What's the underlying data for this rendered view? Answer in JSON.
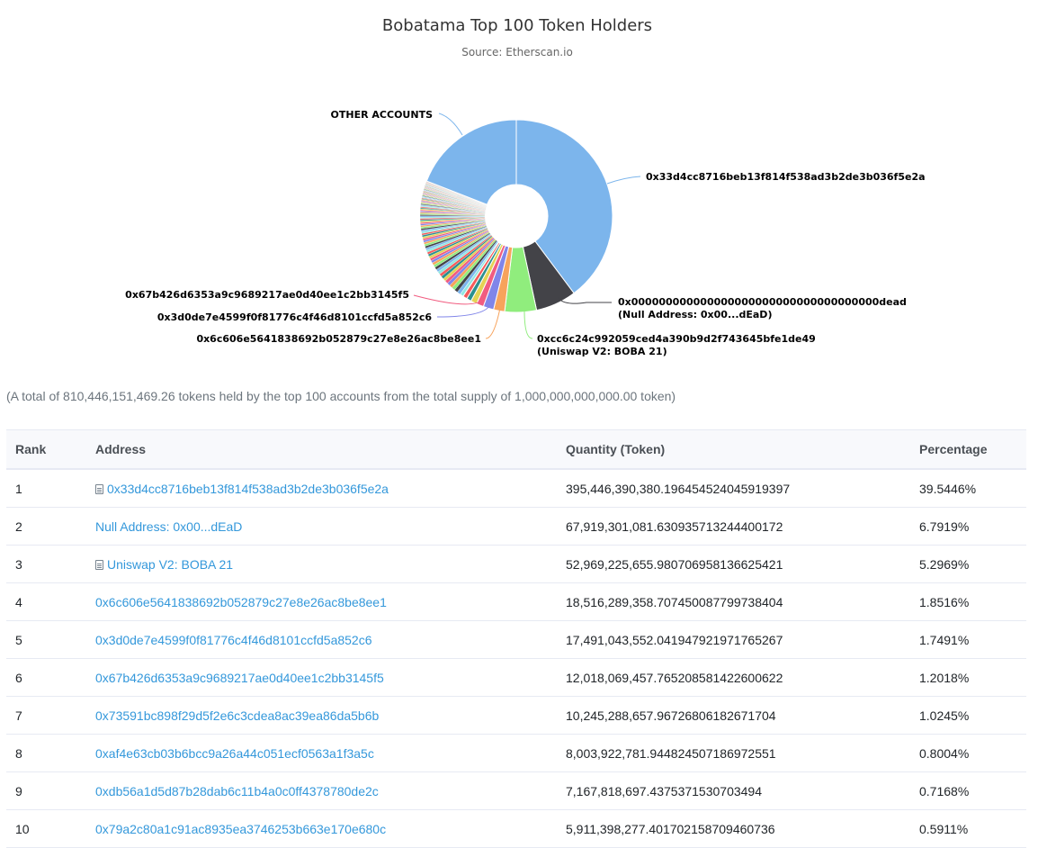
{
  "chart_data": {
    "type": "pie",
    "title": "Bobatama Top 100 Token Holders",
    "subtitle": "Source: Etherscan.io",
    "inner_radius_fraction": 0.33,
    "slices": [
      {
        "label": "0x33d4cc8716beb13f814f538ad3b2de3b036f5e2a",
        "value": 39.5446,
        "color": "#7cb5ec",
        "labeled": true
      },
      {
        "label": "0x000000000000000000000000000000000000dead (Null Address: 0x00...dEaD)",
        "value": 6.7919,
        "color": "#434348",
        "labeled": true
      },
      {
        "label": "0xcc6c24c992059ced4a390b9d2f743645bfe1de49 (Uniswap V2: BOBA 21)",
        "value": 5.2969,
        "color": "#90ed7d",
        "labeled": true
      },
      {
        "label": "0x6c606e5641838692b052879c27e8e26ac8be8ee1",
        "value": 1.8516,
        "color": "#f7a35c",
        "labeled": true
      },
      {
        "label": "0x3d0de7e4599f0f81776c4f46d8101ccfd5a852c6",
        "value": 1.7491,
        "color": "#8085e9",
        "labeled": true
      },
      {
        "label": "0x67b426d6353a9c9689217ae0d40ee1c2bb3145f5",
        "value": 1.2018,
        "color": "#f15c80",
        "labeled": true
      },
      {
        "label": "0x73591bc898f29d5f2e6c3cdea8ac39ea86da5b6b",
        "value": 1.0245,
        "color": "#e4d354",
        "labeled": false
      },
      {
        "label": "0xaf4e63cb03b6bcc9a26a44c051ecf0563a1f3a5c",
        "value": 0.8004,
        "color": "#2b908f",
        "labeled": false
      },
      {
        "label": "0xdb56a1d5d87b28dab6c11b4a0c0ff4378780de2c",
        "value": 0.7168,
        "color": "#f45b5b",
        "labeled": false
      },
      {
        "label": "0x79a2c80a1c91ac8935ea3746253b663e170e680c",
        "value": 0.5911,
        "color": "#91e8e1",
        "labeled": false
      },
      {
        "label": "OTHER ACCOUNTS",
        "value": 18.9554,
        "color": "#7cb5ec",
        "labeled": true
      }
    ],
    "tail": {
      "count": 90,
      "total_value": 20.8799,
      "palette": [
        "#7cb5ec",
        "#434348",
        "#90ed7d",
        "#f7a35c",
        "#8085e9",
        "#f15c80",
        "#e4d354",
        "#2b908f",
        "#f45b5b",
        "#91e8e1"
      ]
    },
    "labels": {
      "other": "OTHER ACCOUNTS",
      "s1": "0x33d4cc8716beb13f814f538ad3b2de3b036f5e2a",
      "s2a": "0x000000000000000000000000000000000000dead",
      "s2b": "(Null Address: 0x00...dEaD)",
      "s3a": "0xcc6c24c992059ced4a390b9d2f743645bfe1de49",
      "s3b": "(Uniswap V2: BOBA 21)",
      "s4": "0x6c606e5641838692b052879c27e8e26ac8be8ee1",
      "s5": "0x3d0de7e4599f0f81776c4f46d8101ccfd5a852c6",
      "s6": "0x67b426d6353a9c9689217ae0d40ee1c2bb3145f5"
    }
  },
  "summary": "(A total of 810,446,151,469.26 tokens held by the top 100 accounts from the total supply of 1,000,000,000,000.00 token)",
  "table": {
    "headers": {
      "rank": "Rank",
      "address": "Address",
      "quantity": "Quantity (Token)",
      "percentage": "Percentage"
    },
    "rows": [
      {
        "rank": "1",
        "address": "0x33d4cc8716beb13f814f538ad3b2de3b036f5e2a",
        "contract": true,
        "quantity": "395,446,390,380.196454524045919397",
        "percentage": "39.5446%"
      },
      {
        "rank": "2",
        "address": "Null Address: 0x00...dEaD",
        "contract": false,
        "quantity": "67,919,301,081.630935713244400172",
        "percentage": "6.7919%"
      },
      {
        "rank": "3",
        "address": "Uniswap V2: BOBA 21",
        "contract": true,
        "quantity": "52,969,225,655.980706958136625421",
        "percentage": "5.2969%"
      },
      {
        "rank": "4",
        "address": "0x6c606e5641838692b052879c27e8e26ac8be8ee1",
        "contract": false,
        "quantity": "18,516,289,358.707450087799738404",
        "percentage": "1.8516%"
      },
      {
        "rank": "5",
        "address": "0x3d0de7e4599f0f81776c4f46d8101ccfd5a852c6",
        "contract": false,
        "quantity": "17,491,043,552.041947921971765267",
        "percentage": "1.7491%"
      },
      {
        "rank": "6",
        "address": "0x67b426d6353a9c9689217ae0d40ee1c2bb3145f5",
        "contract": false,
        "quantity": "12,018,069,457.765208581422600622",
        "percentage": "1.2018%"
      },
      {
        "rank": "7",
        "address": "0x73591bc898f29d5f2e6c3cdea8ac39ea86da5b6b",
        "contract": false,
        "quantity": "10,245,288,657.96726806182671704",
        "percentage": "1.0245%"
      },
      {
        "rank": "8",
        "address": "0xaf4e63cb03b6bcc9a26a44c051ecf0563a1f3a5c",
        "contract": false,
        "quantity": "8,003,922,781.944824507186972551",
        "percentage": "0.8004%"
      },
      {
        "rank": "9",
        "address": "0xdb56a1d5d87b28dab6c11b4a0c0ff4378780de2c",
        "contract": false,
        "quantity": "7,167,818,697.4375371530703494",
        "percentage": "0.7168%"
      },
      {
        "rank": "10",
        "address": "0x79a2c80a1c91ac8935ea3746253b663e170e680c",
        "contract": false,
        "quantity": "5,911,398,277.401702158709460736",
        "percentage": "0.5911%"
      }
    ]
  }
}
